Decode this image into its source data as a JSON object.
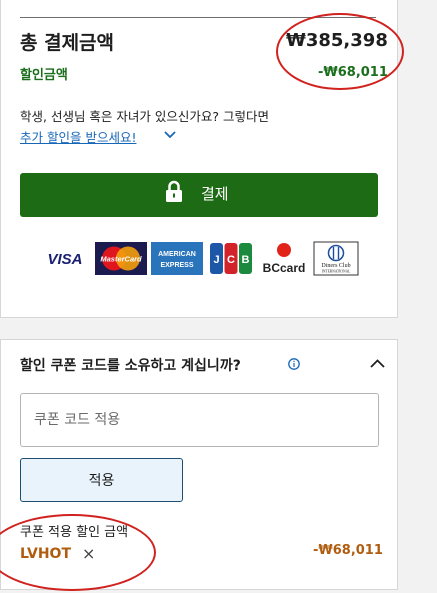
{
  "summary": {
    "total_label": "총 결제금액",
    "total_value": "₩385,398",
    "discount_label": "할인금액",
    "discount_value": "-₩68,011",
    "promo_text": "학생, 선생님 혹은 자녀가 있으신가요? 그렇다면",
    "promo_link": "추가 할인을 받으세요!",
    "pay_button": "결제"
  },
  "payment_logos": [
    {
      "name": "VISA"
    },
    {
      "name": "MasterCard"
    },
    {
      "name": "AMERICAN EXPRESS"
    },
    {
      "name": "JCB"
    },
    {
      "name": "BCcard"
    },
    {
      "name": "Diners Club INTERNATIONAL"
    }
  ],
  "coupon": {
    "question": "할인 쿠폰 코드를 소유하고 계십니까?",
    "input_placeholder": "쿠폰 코드 적용",
    "apply_button": "적용",
    "applied_label": "쿠폰 적용 할인 금액",
    "code": "LVHOT",
    "remove_symbol": "×",
    "applied_amount": "-₩68,011"
  },
  "colors": {
    "pay_green": "#1e6b15",
    "discount_green": "#1b6e1b",
    "coupon_orange": "#b05d10",
    "link_blue": "#1767b8",
    "annotation_red": "#d0221f"
  }
}
